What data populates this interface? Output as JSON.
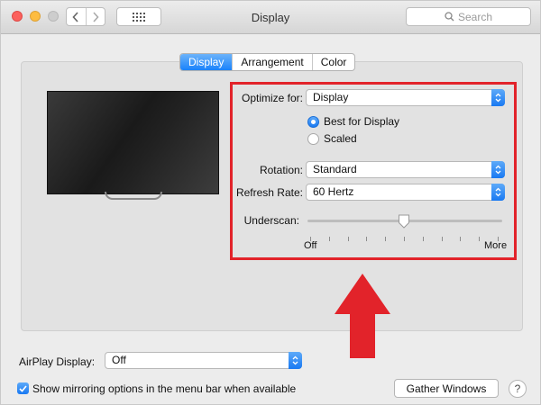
{
  "window": {
    "title": "Display"
  },
  "search": {
    "placeholder": "Search"
  },
  "tabs": [
    {
      "label": "Display",
      "active": true
    },
    {
      "label": "Arrangement",
      "active": false
    },
    {
      "label": "Color",
      "active": false
    }
  ],
  "settings": {
    "optimize_label": "Optimize for:",
    "optimize_value": "Display",
    "radio_best": "Best for Display",
    "radio_scaled": "Scaled",
    "selected_radio": "Best for Display",
    "rotation_label": "Rotation:",
    "rotation_value": "Standard",
    "refresh_label": "Refresh Rate:",
    "refresh_value": "60 Hertz",
    "underscan_label": "Underscan:",
    "underscan_min": "Off",
    "underscan_max": "More",
    "underscan_fraction": 0.5
  },
  "airplay": {
    "label": "AirPlay Display:",
    "value": "Off"
  },
  "mirroring": {
    "label": "Show mirroring options in the menu bar when available",
    "checked": true
  },
  "buttons": {
    "gather": "Gather Windows",
    "help": "?"
  },
  "icons": {
    "back": "chevron-left-icon",
    "forward": "chevron-right-icon",
    "grid": "grid-icon",
    "search": "search-icon",
    "help": "help-icon",
    "arrow": "arrow-up-icon"
  },
  "colors": {
    "accent": "#1979f2",
    "highlight": "#e2232a",
    "arrow": "#e2232a"
  }
}
